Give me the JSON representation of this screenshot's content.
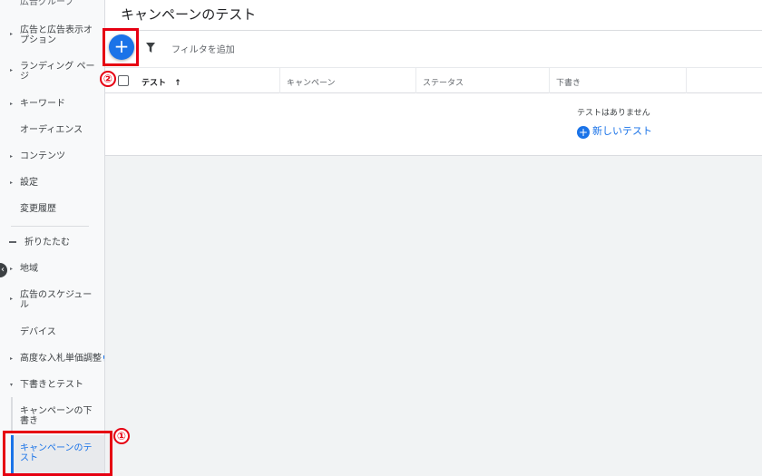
{
  "sidebar": {
    "items": [
      {
        "label": "広告グループ",
        "arrow": false
      },
      {
        "label": "広告と広告表示オプション",
        "arrow": true
      },
      {
        "label": "ランディング ページ",
        "arrow": true
      },
      {
        "label": "キーワード",
        "arrow": true
      },
      {
        "label": "オーディエンス",
        "arrow": false
      },
      {
        "label": "コンテンツ",
        "arrow": true
      },
      {
        "label": "設定",
        "arrow": true
      },
      {
        "label": "変更履歴",
        "arrow": false
      },
      {
        "label": "折りたたむ",
        "arrow": false
      },
      {
        "label": "地域",
        "arrow": true
      },
      {
        "label": "広告のスケジュール",
        "arrow": true
      },
      {
        "label": "デバイス",
        "arrow": false
      },
      {
        "label": "高度な入札単価調整",
        "arrow": true
      },
      {
        "label": "下書きとテスト",
        "arrow": true
      },
      {
        "label": "キャンペーンの下書き",
        "arrow": false
      },
      {
        "label": "キャンペーンのテスト",
        "arrow": false
      }
    ],
    "arrow_glyph": "▸",
    "expanded_glyph": "▾",
    "back_glyph": "‹"
  },
  "main": {
    "title": "キャンペーンのテスト",
    "add_glyph": "+",
    "filter_placeholder": "フィルタを追加",
    "columns": [
      "テスト",
      "キャンペーン",
      "ステータス",
      "下書き"
    ],
    "sort_indicator": "↑",
    "empty_message": "テストはありません",
    "new_test_label": "新しいテスト",
    "new_test_glyph": "+"
  },
  "annotations": {
    "marker_1": "①",
    "marker_2": "②",
    "color": "#e60012"
  },
  "colors": {
    "accent": "#1a73e8",
    "sidebar_bg": "#f8f9fa",
    "content_bg": "#f1f3f4"
  }
}
